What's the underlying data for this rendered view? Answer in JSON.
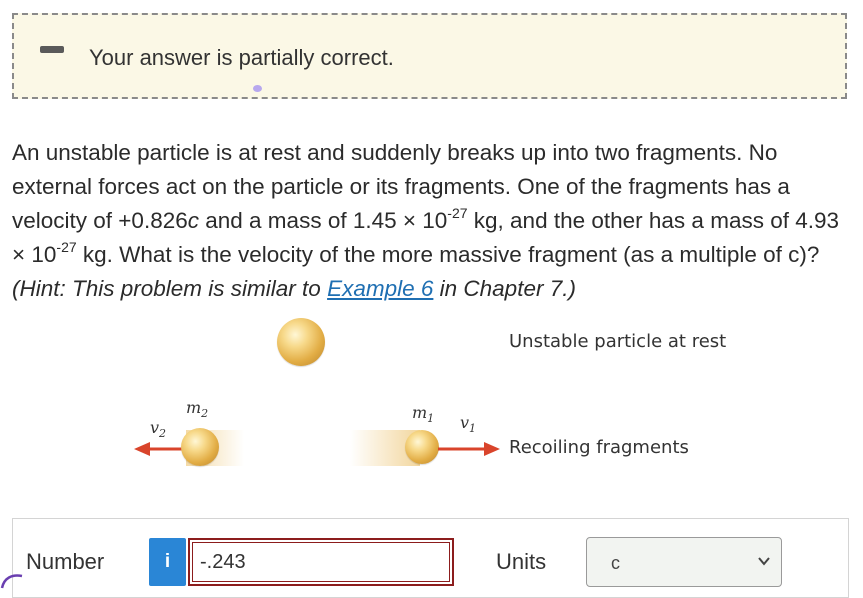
{
  "feedback": {
    "message": "Your answer is partially correct."
  },
  "problem": {
    "text_a": "An unstable particle is at rest and suddenly breaks up into two fragments. No external forces act on the particle or its fragments. One of the fragments has a velocity of +0.826",
    "velocity_unit": "c",
    "text_b": " and a mass of 1.45 × 10",
    "exp1": "-27",
    "text_c": " kg, and the other has a mass of 4.93 × 10",
    "exp2": "-27",
    "text_d": " kg. What is the velocity of the more massive fragment (as a multiple of c)? ",
    "hint_prefix": "(Hint: This problem is similar to ",
    "hint_link": "Example 6",
    "hint_suffix": " in Chapter 7.)"
  },
  "figure": {
    "caption_top": "Unstable particle at rest",
    "caption_bottom": "Recoiling fragments",
    "m2_symbol": "m",
    "m2_sub": "2",
    "v2_symbol": "v",
    "v2_sub": "2",
    "m1_symbol": "m",
    "m1_sub": "1",
    "v1_symbol": "v",
    "v1_sub": "1",
    "arrow_color": "#d9442b",
    "ball_color": "#e8b54e"
  },
  "answer": {
    "number_label": "Number",
    "info_label": "i",
    "number_value": "-.243",
    "units_label": "Units",
    "units_value": "c"
  },
  "colors": {
    "feedback_bg": "#fbf8e6",
    "info_button": "#2a86d6",
    "input_border_error": "#8c1d1d",
    "link": "#1f6fb2"
  }
}
